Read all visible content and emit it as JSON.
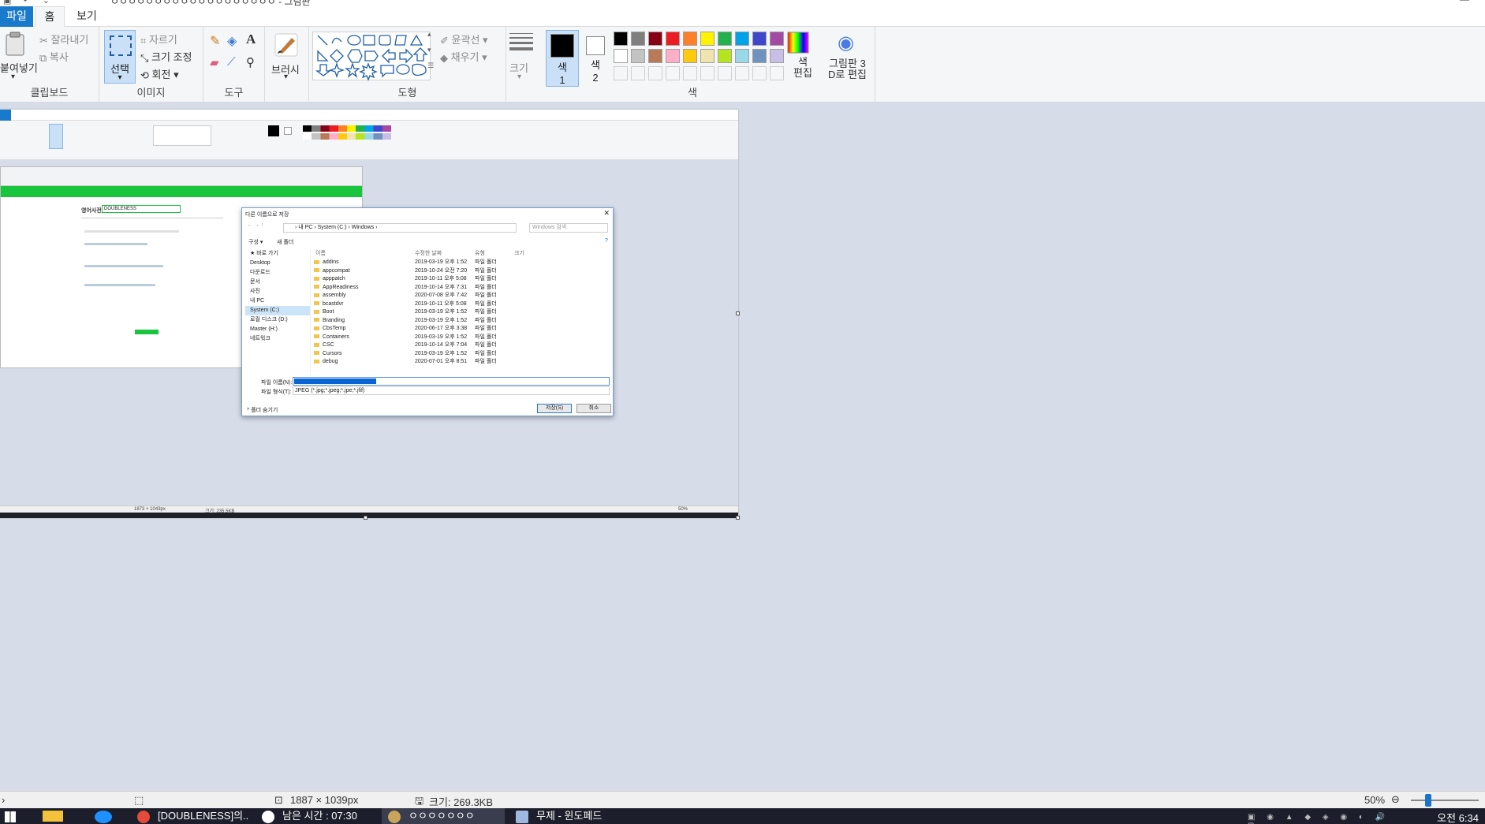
{
  "window": {
    "title": "ㅇㅇㅇㅇㅇㅇㅇㅇㅇㅇㅇㅇㅇㅇㅇㅇㅇㅇㅇ - 그림판",
    "quick_access": "▣ ↶ ⌄"
  },
  "tabs": {
    "file": "파일",
    "home": "홈",
    "view": "보기"
  },
  "ribbon": {
    "clipboard": {
      "paste": "붙여넣기",
      "cut": "잘라내기",
      "copy": "복사",
      "group": "클립보드"
    },
    "image": {
      "select": "선택",
      "crop": "자르기",
      "resize": "크기 조정",
      "rotate": "회전",
      "group": "이미지"
    },
    "tools": {
      "group": "도구"
    },
    "brush": {
      "label": "브러시"
    },
    "shapes": {
      "outline": "윤곽선",
      "fill": "채우기",
      "group": "도형"
    },
    "size": {
      "label": "크기"
    },
    "colors": {
      "color1": "색\n1",
      "color1_a": "색",
      "color1_b": "1",
      "color2_a": "색",
      "color2_b": "2",
      "edit_a": "색",
      "edit_b": "편집",
      "paint3d_a": "그림판 3",
      "paint3d_b": "D로 편집",
      "group": "색",
      "palette_row1": [
        "#000000",
        "#7f7f7f",
        "#880015",
        "#ed1c24",
        "#ff7f27",
        "#fff200",
        "#22b14c",
        "#00a2e8",
        "#3f48cc",
        "#a349a4"
      ],
      "palette_row2": [
        "#ffffff",
        "#c3c3c3",
        "#b97a57",
        "#ffaec9",
        "#ffc90e",
        "#efe4b0",
        "#b5e61d",
        "#99d9ea",
        "#7092be",
        "#c8bfe7"
      ]
    }
  },
  "dialog": {
    "title": "다른 이름으로 저장",
    "address": "› 내 PC › System (C:) › Windows ›",
    "search": "Windows 검색",
    "organize": "구성 ▾",
    "new_folder": "새 폴더",
    "nav": [
      "★ 바로 가기",
      "Desktop",
      "다운로드",
      "문서",
      "사진",
      "내 PC",
      "System (C:)",
      "로컬 디스크 (D:)",
      "Master (H:)",
      "네트워크"
    ],
    "col_name": "이름",
    "col_date": "수정한 날짜",
    "col_type": "유형",
    "col_size": "크기",
    "files": [
      {
        "name": "addins",
        "date": "2019-03-19 오후 1:52",
        "type": "파일 폴더"
      },
      {
        "name": "appcompat",
        "date": "2019-10-24 오전 7:20",
        "type": "파일 폴더"
      },
      {
        "name": "apppatch",
        "date": "2019-10-11 오후 5:08",
        "type": "파일 폴더"
      },
      {
        "name": "AppReadiness",
        "date": "2019-10-14 오후 7:31",
        "type": "파일 폴더"
      },
      {
        "name": "assembly",
        "date": "2020-07-08 오후 7:42",
        "type": "파일 폴더"
      },
      {
        "name": "bcastdvr",
        "date": "2019-10-11 오후 5:08",
        "type": "파일 폴더"
      },
      {
        "name": "Boot",
        "date": "2019-03-19 오후 1:52",
        "type": "파일 폴더"
      },
      {
        "name": "Branding",
        "date": "2019-03-19 오후 1:52",
        "type": "파일 폴더"
      },
      {
        "name": "CbsTemp",
        "date": "2020-06-17 오후 3:38",
        "type": "파일 폴더"
      },
      {
        "name": "Containers",
        "date": "2019-03-19 오후 1:52",
        "type": "파일 폴더"
      },
      {
        "name": "CSC",
        "date": "2019-10-14 오후 7:04",
        "type": "파일 폴더"
      },
      {
        "name": "Cursors",
        "date": "2019-03-19 오후 1:52",
        "type": "파일 폴더"
      },
      {
        "name": "debug",
        "date": "2020-07-01 오후 8:51",
        "type": "파일 폴더"
      }
    ],
    "filename_label": "파일 이름(N):",
    "filetype_label": "파일 형식(T):",
    "filetype": "JPEG (*.jpg;*.jpeg;*.jpe;*.jfif)",
    "hide_folders": "^ 폴더 숨기기",
    "save": "저장(S)",
    "cancel": "취소"
  },
  "browser": {
    "dict_title": "영어사전",
    "query": "DOUBLENESS"
  },
  "mini_status": {
    "dims": "1873 × 1043px",
    "size": "크기: 235.5KB",
    "zoom": "50%"
  },
  "status": {
    "dims": "1887 × 1039px",
    "size": "크기: 269.3KB",
    "zoom": "50%"
  },
  "taskbar": {
    "apps": [
      "[DOUBLENESS]의...",
      "남은 시간 : 07:30",
      "ㅇㅇㅇㅇㅇㅇㅇ",
      "무제 - 윈도페드"
    ],
    "clock": "오전 6:34"
  }
}
